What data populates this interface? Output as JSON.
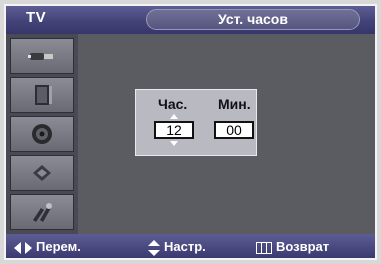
{
  "header": {
    "source": "TV",
    "title": "Уст. часов"
  },
  "sidebar": {
    "items": [
      {
        "icon": "input-plug-icon"
      },
      {
        "icon": "picture-icon"
      },
      {
        "icon": "sound-icon"
      },
      {
        "icon": "channel-icon"
      },
      {
        "icon": "setup-icon"
      }
    ]
  },
  "clock": {
    "hour_label": "Час.",
    "minute_label": "Мин.",
    "hour_value": "12",
    "minute_value": "00"
  },
  "footer": {
    "move_label": "Перем.",
    "adjust_label": "Настр.",
    "return_label": "Возврат"
  }
}
